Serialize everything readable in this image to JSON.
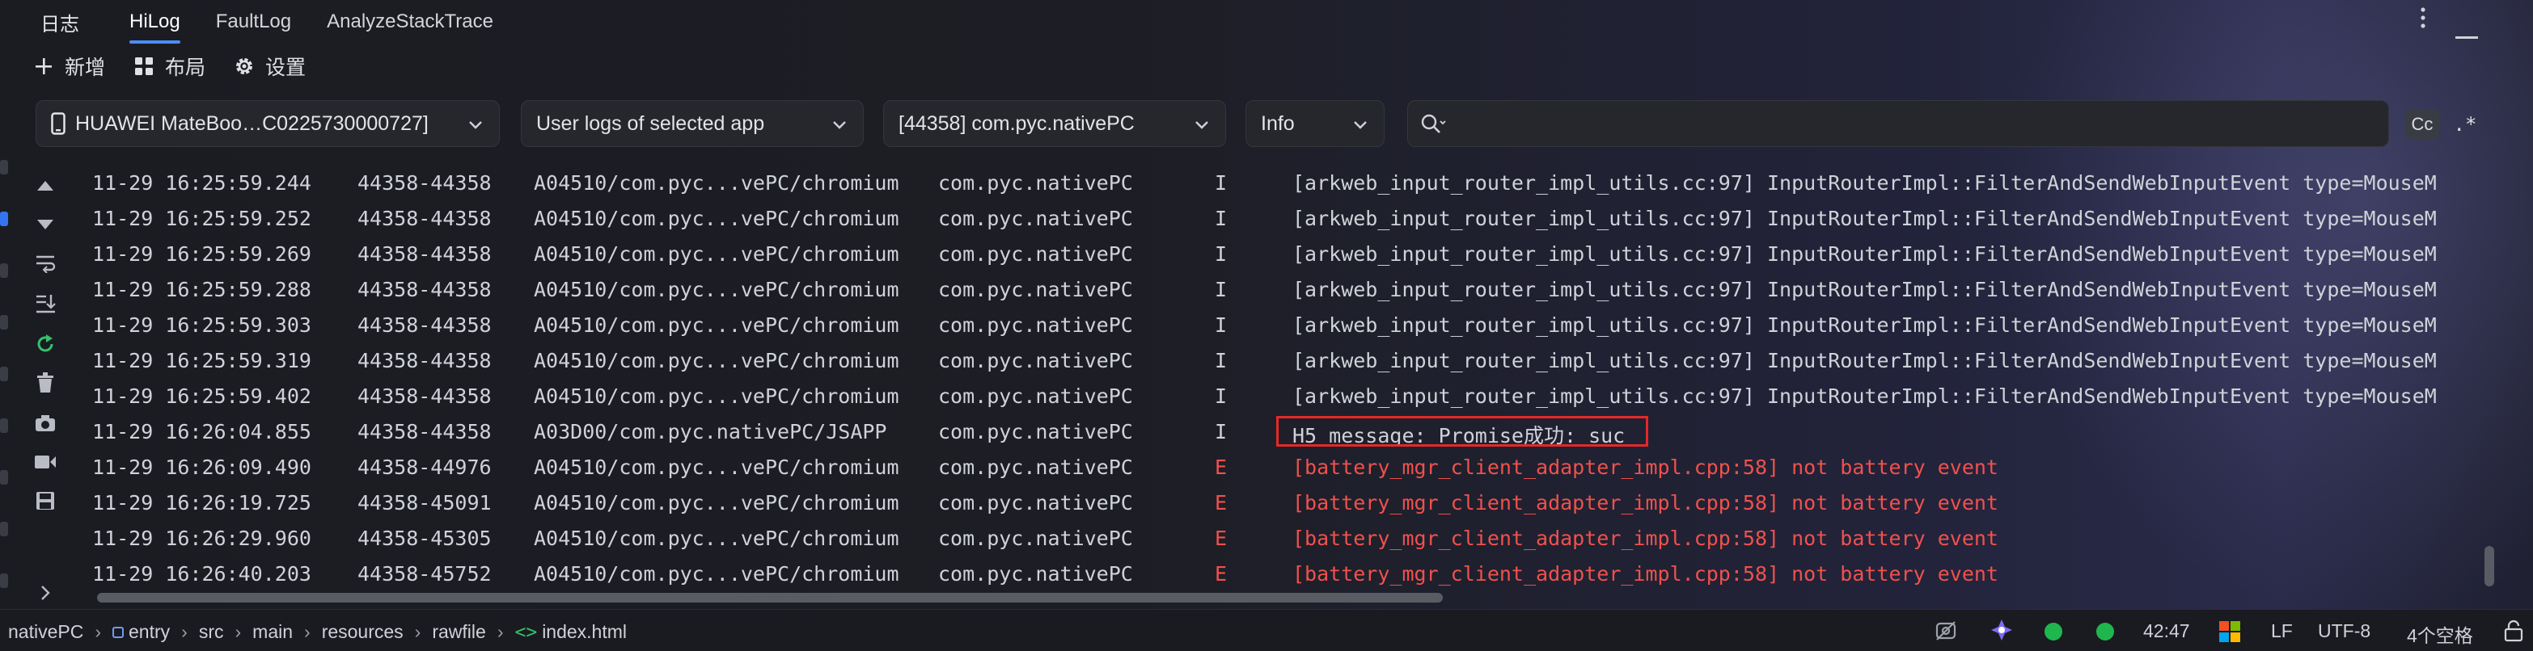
{
  "panel": {
    "title": "日志",
    "tabs": [
      {
        "label": "HiLog",
        "active": true
      },
      {
        "label": "FaultLog",
        "active": false
      },
      {
        "label": "AnalyzeStackTrace",
        "active": false
      }
    ]
  },
  "toolbar": {
    "add_label": "新增",
    "layout_label": "布局",
    "settings_label": "设置"
  },
  "filters": {
    "device": "HUAWEI MateBoo…C0225730000727]",
    "scope": "User logs of selected app",
    "process": "[44358] com.pyc.nativePC",
    "level": "Info",
    "search_value": "",
    "case_label": "Cc",
    "regex_label": ".*"
  },
  "logs": [
    {
      "time": "11-29 16:25:59.244",
      "pid": "44358-44358",
      "tag": "A04510/com.pyc...vePC/chromium",
      "pkg": "com.pyc.nativePC",
      "level": "I",
      "msg": "[arkweb_input_router_impl_utils.cc:97] InputRouterImpl::FilterAndSendWebInputEvent type=MouseM"
    },
    {
      "time": "11-29 16:25:59.252",
      "pid": "44358-44358",
      "tag": "A04510/com.pyc...vePC/chromium",
      "pkg": "com.pyc.nativePC",
      "level": "I",
      "msg": "[arkweb_input_router_impl_utils.cc:97] InputRouterImpl::FilterAndSendWebInputEvent type=MouseM"
    },
    {
      "time": "11-29 16:25:59.269",
      "pid": "44358-44358",
      "tag": "A04510/com.pyc...vePC/chromium",
      "pkg": "com.pyc.nativePC",
      "level": "I",
      "msg": "[arkweb_input_router_impl_utils.cc:97] InputRouterImpl::FilterAndSendWebInputEvent type=MouseM"
    },
    {
      "time": "11-29 16:25:59.288",
      "pid": "44358-44358",
      "tag": "A04510/com.pyc...vePC/chromium",
      "pkg": "com.pyc.nativePC",
      "level": "I",
      "msg": "[arkweb_input_router_impl_utils.cc:97] InputRouterImpl::FilterAndSendWebInputEvent type=MouseM"
    },
    {
      "time": "11-29 16:25:59.303",
      "pid": "44358-44358",
      "tag": "A04510/com.pyc...vePC/chromium",
      "pkg": "com.pyc.nativePC",
      "level": "I",
      "msg": "[arkweb_input_router_impl_utils.cc:97] InputRouterImpl::FilterAndSendWebInputEvent type=MouseM"
    },
    {
      "time": "11-29 16:25:59.319",
      "pid": "44358-44358",
      "tag": "A04510/com.pyc...vePC/chromium",
      "pkg": "com.pyc.nativePC",
      "level": "I",
      "msg": "[arkweb_input_router_impl_utils.cc:97] InputRouterImpl::FilterAndSendWebInputEvent type=MouseM"
    },
    {
      "time": "11-29 16:25:59.402",
      "pid": "44358-44358",
      "tag": "A04510/com.pyc...vePC/chromium",
      "pkg": "com.pyc.nativePC",
      "level": "I",
      "msg": "[arkweb_input_router_impl_utils.cc:97] InputRouterImpl::FilterAndSendWebInputEvent type=MouseM"
    },
    {
      "time": "11-29 16:26:04.855",
      "pid": "44358-44358",
      "tag": "A03D00/com.pyc.nativePC/JSAPP",
      "pkg": "com.pyc.nativePC",
      "level": "I",
      "msg": "H5 message: Promise成功: suc",
      "highlighted": true
    },
    {
      "time": "11-29 16:26:09.490",
      "pid": "44358-44976",
      "tag": "A04510/com.pyc...vePC/chromium",
      "pkg": "com.pyc.nativePC",
      "level": "E",
      "msg": "[battery_mgr_client_adapter_impl.cpp:58] not battery event"
    },
    {
      "time": "11-29 16:26:19.725",
      "pid": "44358-45091",
      "tag": "A04510/com.pyc...vePC/chromium",
      "pkg": "com.pyc.nativePC",
      "level": "E",
      "msg": "[battery_mgr_client_adapter_impl.cpp:58] not battery event"
    },
    {
      "time": "11-29 16:26:29.960",
      "pid": "44358-45305",
      "tag": "A04510/com.pyc...vePC/chromium",
      "pkg": "com.pyc.nativePC",
      "level": "E",
      "msg": "[battery_mgr_client_adapter_impl.cpp:58] not battery event"
    },
    {
      "time": "11-29 16:26:40.203",
      "pid": "44358-45752",
      "tag": "A04510/com.pyc...vePC/chromium",
      "pkg": "com.pyc.nativePC",
      "level": "E",
      "msg": "[battery_mgr_client_adapter_impl.cpp:58] not battery event"
    }
  ],
  "statusbar": {
    "breadcrumb": [
      "nativePC",
      "entry",
      "src",
      "main",
      "resources",
      "rawfile",
      "index.html"
    ],
    "cursor": "42:47",
    "line_ending": "LF",
    "encoding": "UTF-8",
    "indent": "4个空格"
  },
  "colors": {
    "accent": "#4c8df6",
    "error": "#f0514d",
    "highlight_border": "#e52828",
    "status_ok": "#1fb64e"
  },
  "icons": [
    "plus-icon",
    "grid-icon",
    "gear-icon",
    "phone-icon",
    "chevron-down-icon",
    "search-icon",
    "more-icon",
    "minimize-icon",
    "arrow-up-icon",
    "arrow-down-icon",
    "wrap-icon",
    "scroll-end-icon",
    "restart-icon",
    "trash-icon",
    "camera-icon",
    "video-icon",
    "save-icon",
    "chevron-right-icon",
    "module-icon",
    "code-icon",
    "no-eye-icon",
    "ai-icon",
    "windows-icon",
    "lock-icon"
  ]
}
